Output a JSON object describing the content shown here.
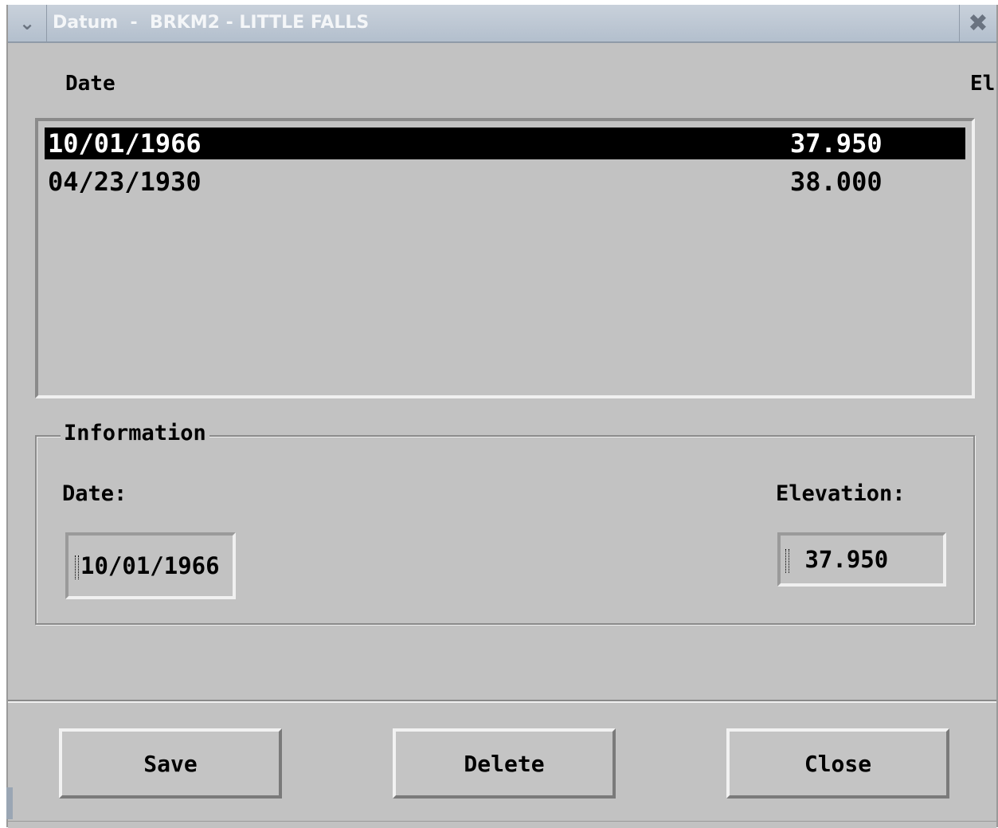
{
  "window": {
    "title": "Datum  -  BRKM2 - LITTLE FALLS"
  },
  "list": {
    "headers": {
      "date": "Date",
      "elevation": "El"
    },
    "rows": [
      {
        "date": "10/01/1966",
        "elevation": "37.950",
        "selected": true
      },
      {
        "date": "04/23/1930",
        "elevation": "38.000",
        "selected": false
      }
    ]
  },
  "information": {
    "group_title": "Information",
    "date_label": "Date:",
    "date_value": "10/01/1966",
    "elevation_label": "Elevation:",
    "elevation_value": " 37.950"
  },
  "buttons": {
    "save": "Save",
    "delete": "Delete",
    "close": "Close"
  },
  "icons": {
    "window_menu": "chevron-down-icon",
    "window_close": "close-icon"
  }
}
